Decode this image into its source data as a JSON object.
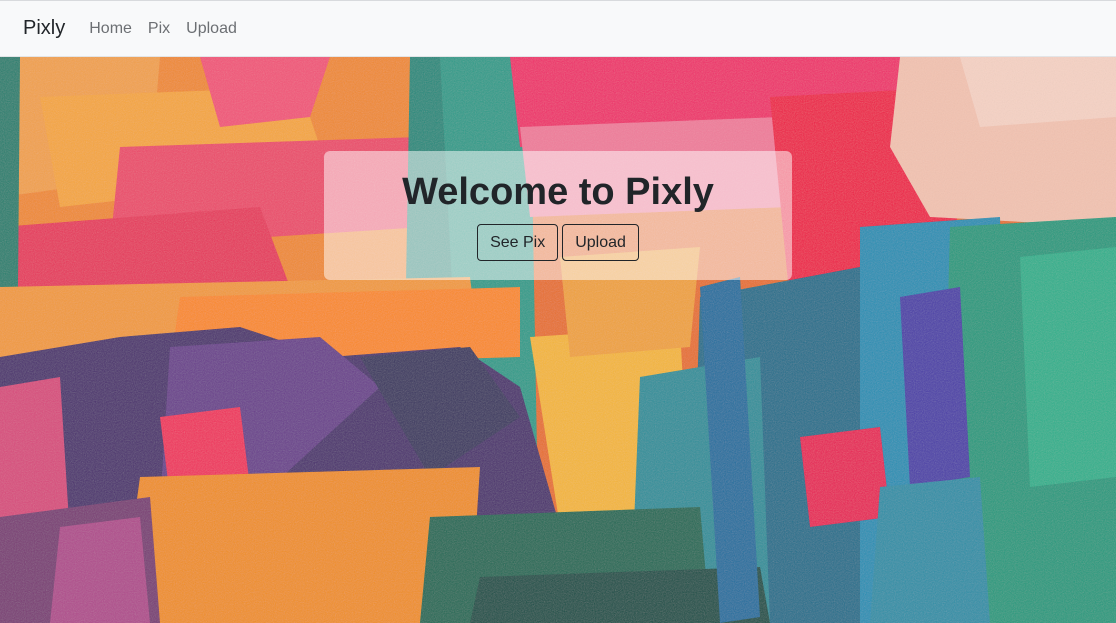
{
  "navbar": {
    "brand": "Pixly",
    "links": [
      "Home",
      "Pix",
      "Upload"
    ]
  },
  "hero": {
    "title": "Welcome to Pixly",
    "buttons": [
      "See Pix",
      "Upload"
    ],
    "background": "abstract-paint-strokes-image"
  },
  "colors": {
    "navbar_bg": "#f8f9fa",
    "text": "#212529",
    "nav_link": "#6c6f73"
  }
}
